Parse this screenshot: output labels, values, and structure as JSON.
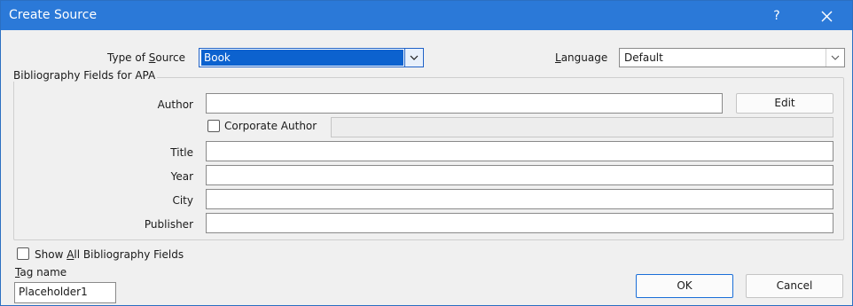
{
  "window": {
    "title": "Create Source",
    "help_label": "?",
    "close_icon": "close-icon"
  },
  "type_of_source": {
    "label_pre": "Type of ",
    "label_key": "S",
    "label_post": "ource",
    "value": "Book"
  },
  "language": {
    "label_key": "L",
    "label_post": "anguage",
    "value": "Default"
  },
  "group": {
    "legend": "Bibliography Fields for APA"
  },
  "fields": {
    "author_label": "Author",
    "author_value": "",
    "edit_label": "Edit",
    "corporate_label": "Corporate Author",
    "corporate_value": "",
    "title_label": "Title",
    "title_value": "",
    "year_label": "Year",
    "year_value": "",
    "city_label": "City",
    "city_value": "",
    "publisher_label": "Publisher",
    "publisher_value": ""
  },
  "show_all": {
    "pre": "Show ",
    "key": "A",
    "post": "ll Bibliography Fields"
  },
  "tag": {
    "label_key": "T",
    "label_post": "ag name",
    "value": "Placeholder1"
  },
  "buttons": {
    "ok": "OK",
    "cancel": "Cancel"
  },
  "colors": {
    "titlebar": "#2b79d8",
    "selection": "#0c62cf",
    "background": "#f0f0f0"
  }
}
